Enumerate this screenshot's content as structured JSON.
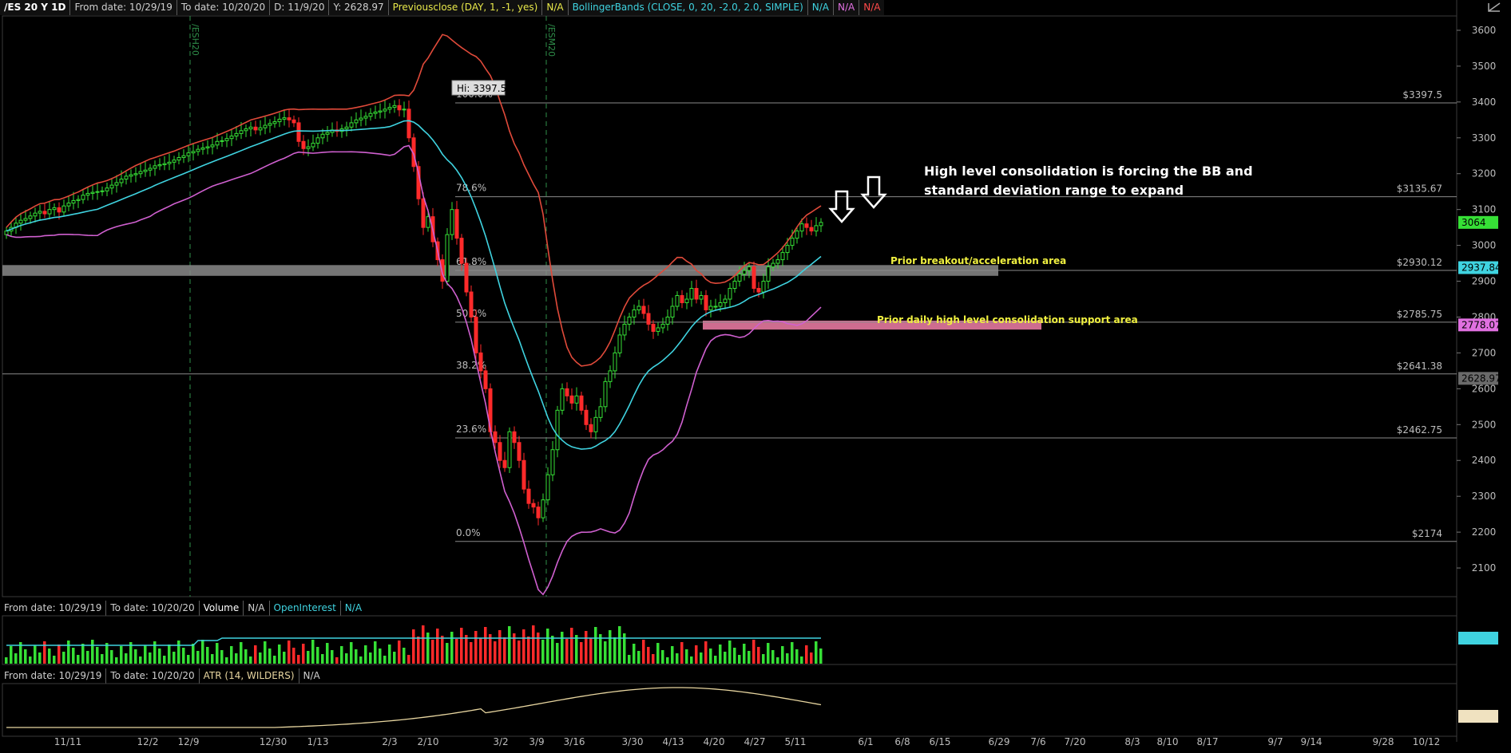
{
  "header": {
    "symbol": "/ES 20 Y 1D",
    "from_date": "From date: 10/29/19",
    "to_date": "To date: 10/20/20",
    "d_label": "D: 11/9/20",
    "y_label": "Y: 2628.97",
    "prevclose": "Previousclose (DAY, 1, -1, yes)",
    "prevclose_val": "N/A",
    "bb": "BollingerBands (CLOSE, 0, 20, -2.0, 2.0, SIMPLE)",
    "bb_val1": "N/A",
    "bb_val2": "N/A",
    "bb_val3": "N/A"
  },
  "volume_header": {
    "from_date": "From date: 10/29/19",
    "to_date": "To date: 10/20/20",
    "volume": "Volume",
    "volume_val": "N/A",
    "oi": "OpenInterest",
    "oi_val": "N/A"
  },
  "atr_header": {
    "from_date": "From date: 10/29/19",
    "to_date": "To date: 10/20/20",
    "atr": "ATR (14, WILDERS)",
    "atr_val": "N/A"
  },
  "chart_data": {
    "type": "candlestick",
    "x_ticks": [
      "11/11",
      "12/2",
      "12/9",
      "12/30",
      "1/13",
      "2/3",
      "2/10",
      "3/2",
      "3/9",
      "3/16",
      "3/30",
      "4/13",
      "4/20",
      "4/27",
      "5/11",
      "6/1",
      "6/8",
      "6/15",
      "6/29",
      "7/6",
      "7/20",
      "8/3",
      "8/10",
      "8/17",
      "9/7",
      "9/14",
      "9/28",
      "10/12"
    ],
    "y_ticks": [
      2100,
      2200,
      2300,
      2400,
      2500,
      2600,
      2700,
      2800,
      2900,
      3000,
      3100,
      3200,
      3300,
      3400,
      3500,
      3600
    ],
    "ylim": [
      2020,
      3640
    ],
    "contract_roll_labels": [
      "/ESH20",
      "/ESM20"
    ],
    "high_marker": "Hi: 3397.5",
    "fib_levels": [
      {
        "pct": "0.0%",
        "price_label": "$2174",
        "value": 2174
      },
      {
        "pct": "23.6%",
        "price_label": "$2462.75",
        "value": 2462.75
      },
      {
        "pct": "38.2%",
        "price_label": "$2641.38",
        "value": 2641.38
      },
      {
        "pct": "50.0%",
        "price_label": "$2785.75",
        "value": 2785.75
      },
      {
        "pct": "61.8%",
        "price_label": "$2930.12",
        "value": 2930.12
      },
      {
        "pct": "78.6%",
        "price_label": "$3135.67",
        "value": 3135.67
      },
      {
        "pct": "100.0%",
        "price_label": "$3397.5",
        "value": 3397.5
      }
    ],
    "price_badges": [
      {
        "label": "3064",
        "value": 3064,
        "color": "#36e036",
        "text": "#000"
      },
      {
        "label": "2937.84",
        "value": 2937.84,
        "color": "#3fd3e0",
        "text": "#000"
      },
      {
        "label": "2778.07",
        "value": 2778.07,
        "color": "#e070e0",
        "text": "#000"
      },
      {
        "label": "2628.97",
        "value": 2628.97,
        "color": "#6a6a6a",
        "text": "#000"
      }
    ],
    "zones": [
      {
        "label": "Prior breakout/acceleration area",
        "low": 2915,
        "high": 2945,
        "color": "#8a8a8a"
      },
      {
        "label": "Prior daily high level consolidation support area",
        "low": 2765,
        "high": 2790,
        "color": "#f27fa8"
      }
    ],
    "annotation": [
      "High level consolidation is forcing the BB and",
      "standard deviation range to expand"
    ],
    "close_series": [
      3040,
      3050,
      3062,
      3070,
      3075,
      3082,
      3090,
      3095,
      3088,
      3100,
      3105,
      3093,
      3110,
      3118,
      3125,
      3128,
      3140,
      3145,
      3148,
      3150,
      3152,
      3160,
      3168,
      3175,
      3185,
      3193,
      3197,
      3200,
      3206,
      3210,
      3215,
      3222,
      3225,
      3228,
      3232,
      3238,
      3245,
      3250,
      3258,
      3262,
      3268,
      3272,
      3275,
      3280,
      3290,
      3292,
      3298,
      3305,
      3312,
      3320,
      3325,
      3330,
      3322,
      3328,
      3335,
      3340,
      3345,
      3352,
      3356,
      3350,
      3342,
      3290,
      3270,
      3275,
      3285,
      3300,
      3310,
      3315,
      3322,
      3318,
      3325,
      3330,
      3342,
      3350,
      3355,
      3360,
      3368,
      3372,
      3375,
      3380,
      3385,
      3390,
      3378,
      3380,
      3300,
      3220,
      3130,
      3050,
      3080,
      3010,
      2960,
      2900,
      3030,
      3100,
      3020,
      2950,
      2870,
      2800,
      2700,
      2650,
      2600,
      2480,
      2450,
      2400,
      2380,
      2480,
      2450,
      2400,
      2320,
      2280,
      2270,
      2240,
      2290,
      2360,
      2430,
      2540,
      2600,
      2580,
      2560,
      2580,
      2540,
      2500,
      2480,
      2520,
      2550,
      2620,
      2650,
      2700,
      2750,
      2780,
      2800,
      2820,
      2830,
      2810,
      2780,
      2760,
      2770,
      2780,
      2800,
      2830,
      2860,
      2840,
      2850,
      2880,
      2850,
      2860,
      2820,
      2830,
      2830,
      2840,
      2850,
      2880,
      2900,
      2920,
      2930,
      2940,
      2880,
      2870,
      2900,
      2940,
      2950,
      2960,
      2980,
      3000,
      3020,
      3040,
      3060,
      3050,
      3040,
      3055,
      3064
    ]
  }
}
